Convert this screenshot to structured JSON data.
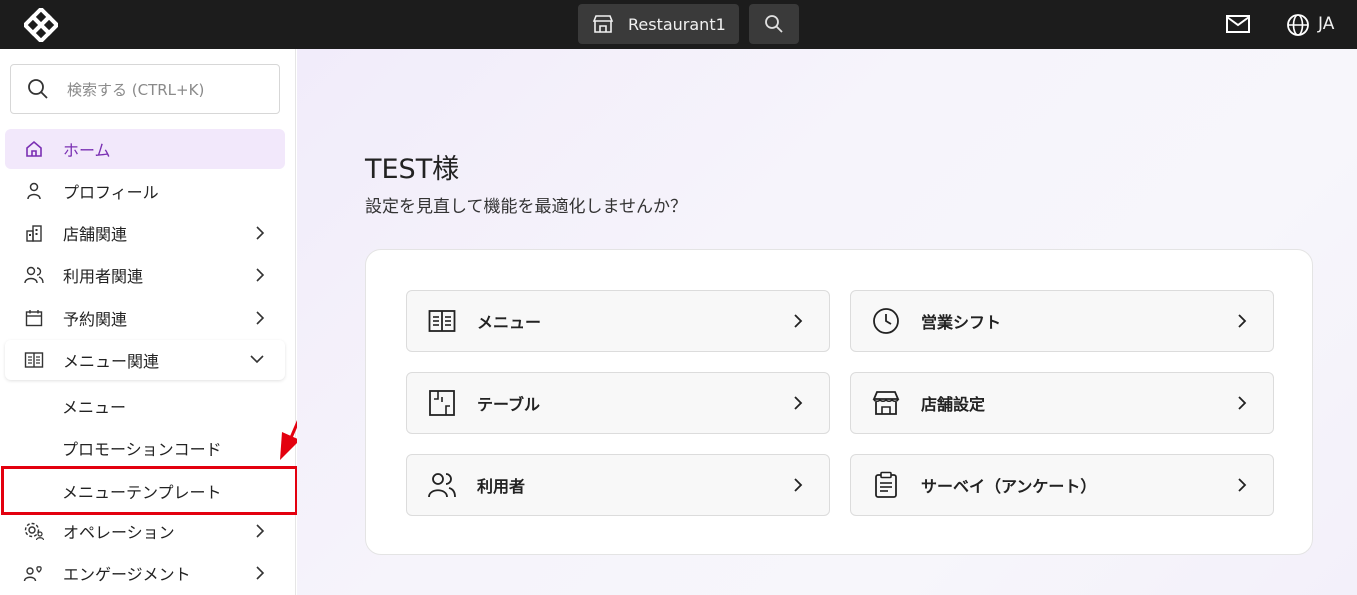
{
  "topbar": {
    "store_name": "Restaurant1",
    "language": "JA"
  },
  "sidebar": {
    "search_placeholder": "検索する (CTRL+K)",
    "items": [
      {
        "label": "ホーム",
        "icon": "home-icon",
        "active": true
      },
      {
        "label": "プロフィール",
        "icon": "user-icon"
      },
      {
        "label": "店舗関連",
        "icon": "building-icon"
      },
      {
        "label": "利用者関連",
        "icon": "users-icon"
      },
      {
        "label": "予約関連",
        "icon": "calendar-icon"
      },
      {
        "label": "メニュー関連",
        "icon": "menu-book-icon",
        "expanded": true
      },
      {
        "label": "オペレーション",
        "icon": "gear-people-icon"
      },
      {
        "label": "エンゲージメント",
        "icon": "heart-people-icon"
      }
    ],
    "subitems": [
      "メニュー",
      "プロモーションコード",
      "メニューテンプレート"
    ]
  },
  "main": {
    "greeting": "TEST様",
    "subtitle": "設定を見直して機能を最適化しませんか？",
    "tiles": [
      {
        "label": "メニュー",
        "icon": "menu-book-icon"
      },
      {
        "label": "営業シフト",
        "icon": "clock-icon"
      },
      {
        "label": "テーブル",
        "icon": "floorplan-icon"
      },
      {
        "label": "店舗設定",
        "icon": "store-icon"
      },
      {
        "label": "利用者",
        "icon": "users-icon"
      },
      {
        "label": "サーベイ（アンケート）",
        "icon": "clipboard-icon"
      }
    ]
  },
  "colors": {
    "topbar": "#1c1c1c",
    "accent": "#7a2fb3",
    "highlight": "#e3000f"
  }
}
